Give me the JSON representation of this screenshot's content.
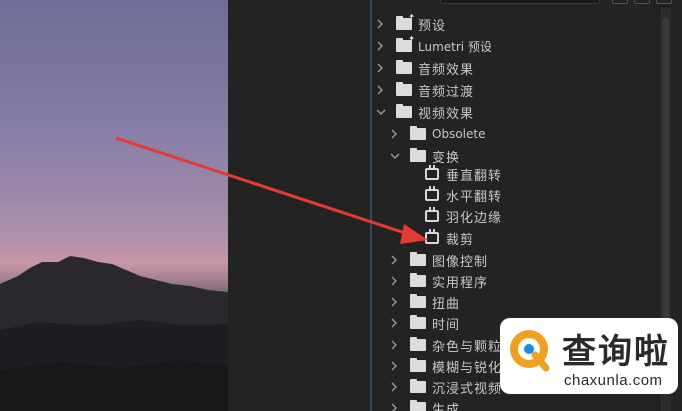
{
  "effects_tree": {
    "items": [
      {
        "label": "预设",
        "expanded": false,
        "icon": "preset-folder-icon"
      },
      {
        "label": "Lumetri 预设",
        "expanded": false,
        "icon": "preset-folder-icon"
      },
      {
        "label": "音频效果",
        "expanded": false,
        "icon": "folder-icon"
      },
      {
        "label": "音频过渡",
        "expanded": false,
        "icon": "folder-icon"
      },
      {
        "label": "视频效果",
        "expanded": true,
        "icon": "folder-icon"
      },
      {
        "label": "Obsolete",
        "expanded": false,
        "icon": "folder-icon"
      },
      {
        "label": "变换",
        "expanded": true,
        "icon": "folder-icon"
      },
      {
        "label": "垂直翻转",
        "icon": "effect-icon"
      },
      {
        "label": "水平翻转",
        "icon": "effect-icon"
      },
      {
        "label": "羽化边缘",
        "icon": "effect-icon"
      },
      {
        "label": "裁剪",
        "icon": "effect-icon"
      },
      {
        "label": "图像控制",
        "expanded": false,
        "icon": "folder-icon"
      },
      {
        "label": "实用程序",
        "expanded": false,
        "icon": "folder-icon"
      },
      {
        "label": "扭曲",
        "expanded": false,
        "icon": "folder-icon"
      },
      {
        "label": "时间",
        "expanded": false,
        "icon": "folder-icon"
      },
      {
        "label": "杂色与颗粒",
        "expanded": false,
        "icon": "folder-icon"
      },
      {
        "label": "模糊与锐化",
        "expanded": false,
        "icon": "folder-icon"
      },
      {
        "label": "沉浸式视频",
        "expanded": false,
        "icon": "folder-icon"
      },
      {
        "label": "生成",
        "expanded": false,
        "icon": "folder-icon"
      }
    ]
  },
  "annotation": {
    "arrow_color": "#e53935"
  },
  "watermark": {
    "title": "查询啦",
    "url": "chaxunla.com",
    "logo_color": "#f0a020"
  }
}
